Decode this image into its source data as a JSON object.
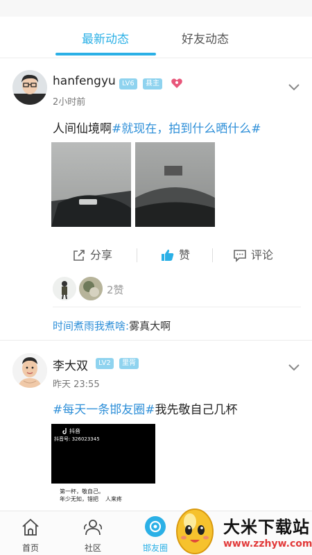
{
  "tabs": {
    "latest": "最新动态",
    "friends": "好友动态"
  },
  "posts": [
    {
      "username": "hanfengyu",
      "level": "LV6",
      "role": "县主",
      "time": "2小时前",
      "content_plain": "人间仙境啊",
      "content_topic": "#就现在，拍到什么晒什么#",
      "actions": {
        "share": "分享",
        "like": "赞",
        "comment": "评论"
      },
      "likes": "2赞",
      "comment_user": "时间煮雨我煮啥:",
      "comment_text": "雾真大啊"
    },
    {
      "username": "李大双",
      "level": "LV2",
      "role": "里胥",
      "time": "昨天 23:55",
      "content_topic": "#每天一条邯友圈#",
      "content_plain": "我先敬自己几杯",
      "video": {
        "app": "抖音",
        "id_line": "抖音号: 326023345",
        "caption1": "第一杯，敬自己。",
        "caption2": "年少无知，错把",
        "caption3": "人来疼"
      }
    }
  ],
  "bottom_nav": {
    "home": "首页",
    "community": "社区",
    "circle": "邯友圈"
  },
  "watermark": {
    "title": "大米下载站",
    "url": "www.zzhyw.com"
  },
  "colors": {
    "accent": "#2bb0e6",
    "topic": "#2e8fd8"
  }
}
